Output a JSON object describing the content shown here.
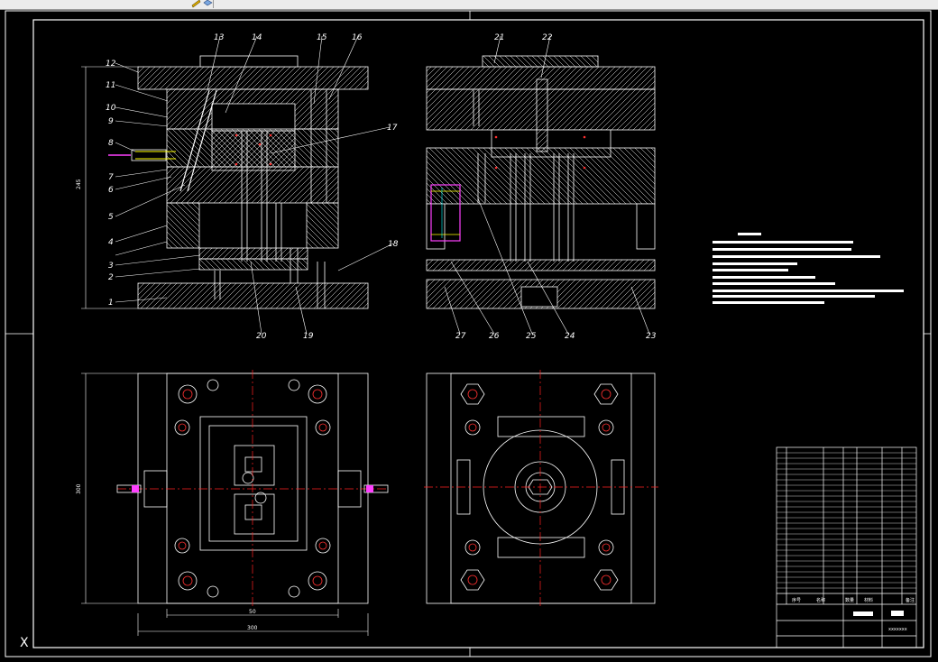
{
  "toolbar": {
    "icons": [
      "measure-icon",
      "layer-icon"
    ]
  },
  "section_view_left": {
    "labels": [
      "1",
      "2",
      "3",
      "4",
      "5",
      "6",
      "7",
      "8",
      "9",
      "10",
      "11",
      "12",
      "13",
      "14",
      "15",
      "16",
      "17",
      "18",
      "19",
      "20"
    ]
  },
  "section_view_right": {
    "labels": [
      "21",
      "22",
      "23",
      "24",
      "25",
      "26",
      "27"
    ]
  },
  "dimensions": {
    "left_height": "245",
    "bottom_height": "300",
    "inner_width": "50",
    "outer_width": "300"
  },
  "title_block": {
    "drawing_no": "xxxxxxx",
    "headers": [
      "序号",
      "名称",
      "数量",
      "材料",
      "备注"
    ]
  },
  "colors": {
    "background": "#000000",
    "line": "#ffffff",
    "centerline": "#ff2020",
    "accent_magenta": "#ff40ff",
    "accent_yellow": "#ffff00",
    "accent_cyan": "#00ffff"
  }
}
